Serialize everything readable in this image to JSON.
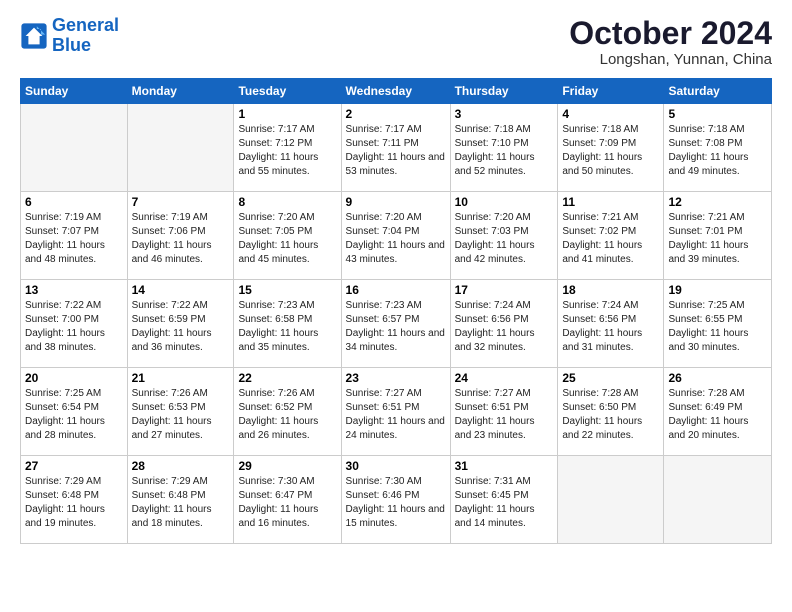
{
  "logo": {
    "line1": "General",
    "line2": "Blue"
  },
  "title": "October 2024",
  "location": "Longshan, Yunnan, China",
  "headers": [
    "Sunday",
    "Monday",
    "Tuesday",
    "Wednesday",
    "Thursday",
    "Friday",
    "Saturday"
  ],
  "weeks": [
    [
      {
        "day": "",
        "sunrise": "",
        "sunset": "",
        "daylight": ""
      },
      {
        "day": "",
        "sunrise": "",
        "sunset": "",
        "daylight": ""
      },
      {
        "day": "1",
        "sunrise": "Sunrise: 7:17 AM",
        "sunset": "Sunset: 7:12 PM",
        "daylight": "Daylight: 11 hours and 55 minutes."
      },
      {
        "day": "2",
        "sunrise": "Sunrise: 7:17 AM",
        "sunset": "Sunset: 7:11 PM",
        "daylight": "Daylight: 11 hours and 53 minutes."
      },
      {
        "day": "3",
        "sunrise": "Sunrise: 7:18 AM",
        "sunset": "Sunset: 7:10 PM",
        "daylight": "Daylight: 11 hours and 52 minutes."
      },
      {
        "day": "4",
        "sunrise": "Sunrise: 7:18 AM",
        "sunset": "Sunset: 7:09 PM",
        "daylight": "Daylight: 11 hours and 50 minutes."
      },
      {
        "day": "5",
        "sunrise": "Sunrise: 7:18 AM",
        "sunset": "Sunset: 7:08 PM",
        "daylight": "Daylight: 11 hours and 49 minutes."
      }
    ],
    [
      {
        "day": "6",
        "sunrise": "Sunrise: 7:19 AM",
        "sunset": "Sunset: 7:07 PM",
        "daylight": "Daylight: 11 hours and 48 minutes."
      },
      {
        "day": "7",
        "sunrise": "Sunrise: 7:19 AM",
        "sunset": "Sunset: 7:06 PM",
        "daylight": "Daylight: 11 hours and 46 minutes."
      },
      {
        "day": "8",
        "sunrise": "Sunrise: 7:20 AM",
        "sunset": "Sunset: 7:05 PM",
        "daylight": "Daylight: 11 hours and 45 minutes."
      },
      {
        "day": "9",
        "sunrise": "Sunrise: 7:20 AM",
        "sunset": "Sunset: 7:04 PM",
        "daylight": "Daylight: 11 hours and 43 minutes."
      },
      {
        "day": "10",
        "sunrise": "Sunrise: 7:20 AM",
        "sunset": "Sunset: 7:03 PM",
        "daylight": "Daylight: 11 hours and 42 minutes."
      },
      {
        "day": "11",
        "sunrise": "Sunrise: 7:21 AM",
        "sunset": "Sunset: 7:02 PM",
        "daylight": "Daylight: 11 hours and 41 minutes."
      },
      {
        "day": "12",
        "sunrise": "Sunrise: 7:21 AM",
        "sunset": "Sunset: 7:01 PM",
        "daylight": "Daylight: 11 hours and 39 minutes."
      }
    ],
    [
      {
        "day": "13",
        "sunrise": "Sunrise: 7:22 AM",
        "sunset": "Sunset: 7:00 PM",
        "daylight": "Daylight: 11 hours and 38 minutes."
      },
      {
        "day": "14",
        "sunrise": "Sunrise: 7:22 AM",
        "sunset": "Sunset: 6:59 PM",
        "daylight": "Daylight: 11 hours and 36 minutes."
      },
      {
        "day": "15",
        "sunrise": "Sunrise: 7:23 AM",
        "sunset": "Sunset: 6:58 PM",
        "daylight": "Daylight: 11 hours and 35 minutes."
      },
      {
        "day": "16",
        "sunrise": "Sunrise: 7:23 AM",
        "sunset": "Sunset: 6:57 PM",
        "daylight": "Daylight: 11 hours and 34 minutes."
      },
      {
        "day": "17",
        "sunrise": "Sunrise: 7:24 AM",
        "sunset": "Sunset: 6:56 PM",
        "daylight": "Daylight: 11 hours and 32 minutes."
      },
      {
        "day": "18",
        "sunrise": "Sunrise: 7:24 AM",
        "sunset": "Sunset: 6:56 PM",
        "daylight": "Daylight: 11 hours and 31 minutes."
      },
      {
        "day": "19",
        "sunrise": "Sunrise: 7:25 AM",
        "sunset": "Sunset: 6:55 PM",
        "daylight": "Daylight: 11 hours and 30 minutes."
      }
    ],
    [
      {
        "day": "20",
        "sunrise": "Sunrise: 7:25 AM",
        "sunset": "Sunset: 6:54 PM",
        "daylight": "Daylight: 11 hours and 28 minutes."
      },
      {
        "day": "21",
        "sunrise": "Sunrise: 7:26 AM",
        "sunset": "Sunset: 6:53 PM",
        "daylight": "Daylight: 11 hours and 27 minutes."
      },
      {
        "day": "22",
        "sunrise": "Sunrise: 7:26 AM",
        "sunset": "Sunset: 6:52 PM",
        "daylight": "Daylight: 11 hours and 26 minutes."
      },
      {
        "day": "23",
        "sunrise": "Sunrise: 7:27 AM",
        "sunset": "Sunset: 6:51 PM",
        "daylight": "Daylight: 11 hours and 24 minutes."
      },
      {
        "day": "24",
        "sunrise": "Sunrise: 7:27 AM",
        "sunset": "Sunset: 6:51 PM",
        "daylight": "Daylight: 11 hours and 23 minutes."
      },
      {
        "day": "25",
        "sunrise": "Sunrise: 7:28 AM",
        "sunset": "Sunset: 6:50 PM",
        "daylight": "Daylight: 11 hours and 22 minutes."
      },
      {
        "day": "26",
        "sunrise": "Sunrise: 7:28 AM",
        "sunset": "Sunset: 6:49 PM",
        "daylight": "Daylight: 11 hours and 20 minutes."
      }
    ],
    [
      {
        "day": "27",
        "sunrise": "Sunrise: 7:29 AM",
        "sunset": "Sunset: 6:48 PM",
        "daylight": "Daylight: 11 hours and 19 minutes."
      },
      {
        "day": "28",
        "sunrise": "Sunrise: 7:29 AM",
        "sunset": "Sunset: 6:48 PM",
        "daylight": "Daylight: 11 hours and 18 minutes."
      },
      {
        "day": "29",
        "sunrise": "Sunrise: 7:30 AM",
        "sunset": "Sunset: 6:47 PM",
        "daylight": "Daylight: 11 hours and 16 minutes."
      },
      {
        "day": "30",
        "sunrise": "Sunrise: 7:30 AM",
        "sunset": "Sunset: 6:46 PM",
        "daylight": "Daylight: 11 hours and 15 minutes."
      },
      {
        "day": "31",
        "sunrise": "Sunrise: 7:31 AM",
        "sunset": "Sunset: 6:45 PM",
        "daylight": "Daylight: 11 hours and 14 minutes."
      },
      {
        "day": "",
        "sunrise": "",
        "sunset": "",
        "daylight": ""
      },
      {
        "day": "",
        "sunrise": "",
        "sunset": "",
        "daylight": ""
      }
    ]
  ]
}
